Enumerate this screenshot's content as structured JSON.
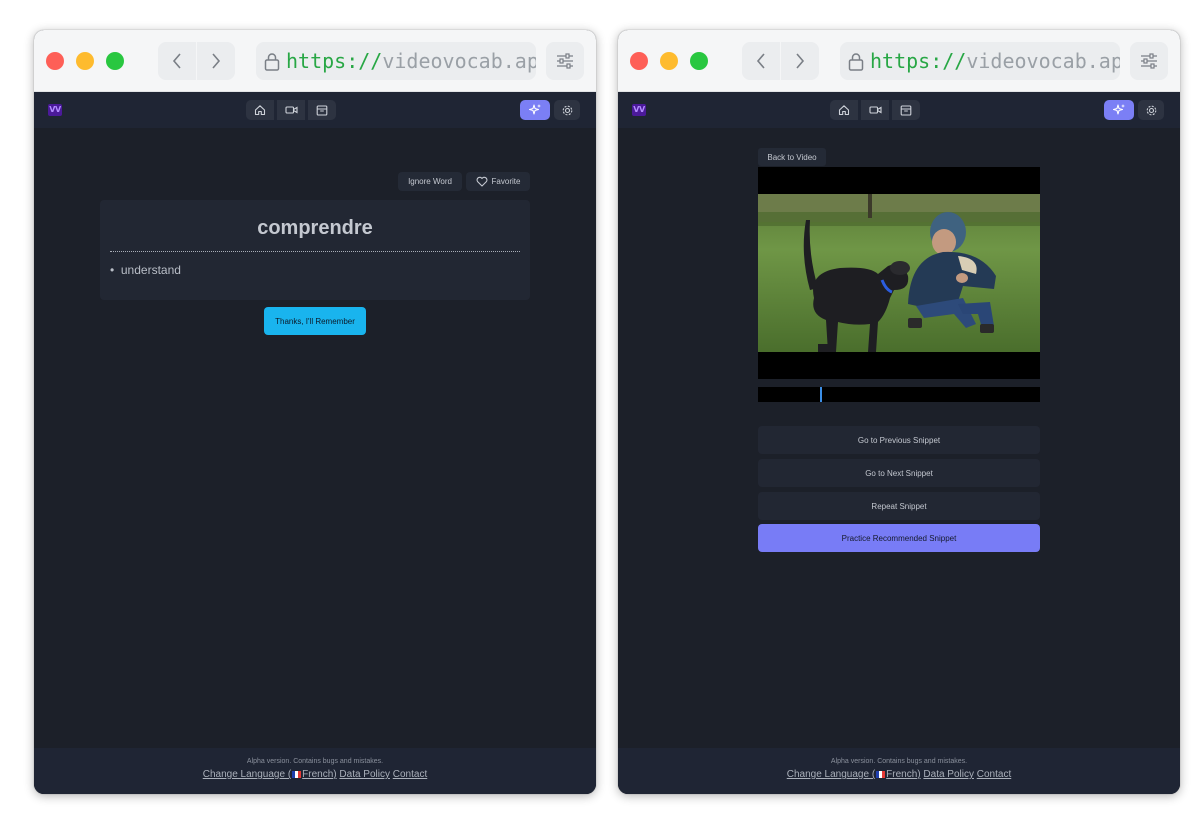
{
  "browser": {
    "url_scheme": "https://",
    "url_host": "videovocab.ap"
  },
  "app": {
    "logo_text": "VV",
    "footer": {
      "note": "Alpha version. Contains bugs and mistakes.",
      "change_language_prefix": "Change Language (",
      "change_language_suffix": "French)",
      "data_policy": "Data Policy",
      "contact": "Contact"
    }
  },
  "left": {
    "ignore_label": "Ignore Word",
    "favorite_label": "Favorite",
    "word": "comprendre",
    "meaning": "understand",
    "remember_label": "Thanks, I'll Remember"
  },
  "right": {
    "back_label": "Back to Video",
    "prev_label": "Go to Previous Snippet",
    "next_label": "Go to Next Snippet",
    "repeat_label": "Repeat Snippet",
    "practice_label": "Practice Recommended Snippet",
    "playhead_position": 0.22
  },
  "colors": {
    "accent": "#7b7ff5",
    "primary_button": "#19b4ee",
    "app_bg": "#1c2029"
  }
}
